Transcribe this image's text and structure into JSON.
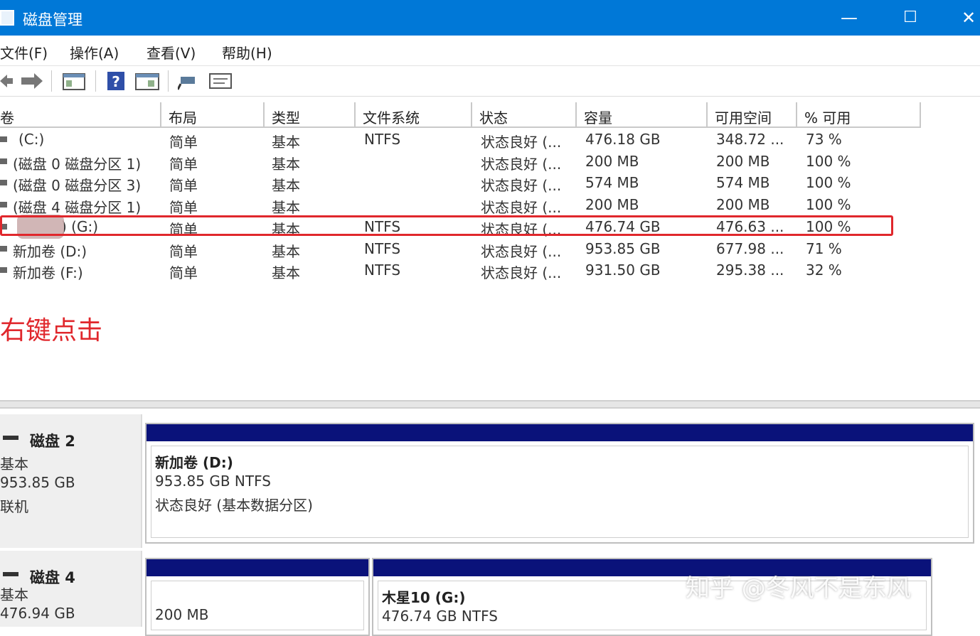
{
  "window": {
    "title": "磁盘管理",
    "minimize": "—",
    "maximize": "☐",
    "close": "✕"
  },
  "menu": [
    "文件(F)",
    "操作(A)",
    "查看(V)",
    "帮助(H)"
  ],
  "columns": [
    "卷",
    "布局",
    "类型",
    "文件系统",
    "状态",
    "容量",
    "可用空间",
    "% 可用"
  ],
  "volumes": [
    {
      "name": "(C:)",
      "layout": "简单",
      "type": "基本",
      "fs": "NTFS",
      "status": "状态良好 (...",
      "capacity": "476.18 GB",
      "free": "348.72 ...",
      "pct": "73 %"
    },
    {
      "name": "(磁盘 0 磁盘分区 1)",
      "layout": "简单",
      "type": "基本",
      "fs": "",
      "status": "状态良好 (...",
      "capacity": "200 MB",
      "free": "200 MB",
      "pct": "100 %"
    },
    {
      "name": "(磁盘 0 磁盘分区 3)",
      "layout": "简单",
      "type": "基本",
      "fs": "",
      "status": "状态良好 (...",
      "capacity": "574 MB",
      "free": "574 MB",
      "pct": "100 %"
    },
    {
      "name": "(磁盘 4 磁盘分区 1)",
      "layout": "简单",
      "type": "基本",
      "fs": "",
      "status": "状态良好 (...",
      "capacity": "200 MB",
      "free": "200 MB",
      "pct": "100 %"
    },
    {
      "name": ") (G:)",
      "layout": "简单",
      "type": "基本",
      "fs": "NTFS",
      "status": "状态良好 (...",
      "capacity": "476.74 GB",
      "free": "476.63 ...",
      "pct": "100 %"
    },
    {
      "name": "新加卷 (D:)",
      "layout": "简单",
      "type": "基本",
      "fs": "NTFS",
      "status": "状态良好 (...",
      "capacity": "953.85 GB",
      "free": "677.98 ...",
      "pct": "71 %"
    },
    {
      "name": "新加卷 (F:)",
      "layout": "简单",
      "type": "基本",
      "fs": "NTFS",
      "status": "状态良好 (...",
      "capacity": "931.50 GB",
      "free": "295.38 ...",
      "pct": "32 %"
    }
  ],
  "annotation": "右键点击",
  "disks": [
    {
      "name": "磁盘 2",
      "type": "基本",
      "size": "953.85 GB",
      "state": "联机",
      "partitions": [
        {
          "title": "新加卷  (D:)",
          "size": "953.85 GB NTFS",
          "status": "状态良好 (基本数据分区)"
        }
      ]
    },
    {
      "name": "磁盘 4",
      "type": "基本",
      "size": "476.94 GB",
      "partitions": [
        {
          "size": "200 MB"
        },
        {
          "title": "木星10  (G:)",
          "size": "476.74 GB NTFS"
        }
      ]
    }
  ],
  "watermark": "知乎 @冬风不是东风",
  "colors": {
    "titlebar": "#0078d7",
    "highlight": "#e0272c",
    "partition_bar": "#0a127a"
  }
}
